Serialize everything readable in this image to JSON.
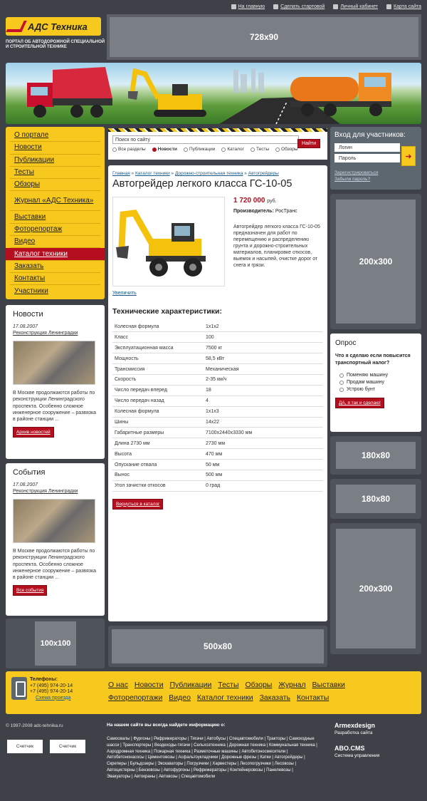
{
  "toplinks": {
    "home": "На главную",
    "start": "Сделать стартовой",
    "cabinet": "Личный кабинет",
    "map": "Карта сайта"
  },
  "logo": {
    "text": "АДС Техника",
    "tagline": "ПОРТАЛ ОБ АВТОДОРОЖНОЙ СПЕЦИАЛЬНОЙ И СТРОИТЕЛЬНОЙ ТЕХНИКЕ"
  },
  "banners": {
    "top": "728x90",
    "r1": "200x300",
    "r2": "180x80",
    "r3": "180x80",
    "r4": "200x300",
    "l1": "100x100",
    "c1": "500x80"
  },
  "nav": [
    "О портале",
    "Новости",
    "Публикации",
    "Тесты",
    "Обзоры",
    "Журнал «АДС Техника»",
    "Выставки",
    "Фоторепортаж",
    "Видео",
    "Каталог техники",
    "Заказать",
    "Контакты",
    "Участники"
  ],
  "news": {
    "title": "Новости",
    "date": "17.08.2007",
    "link": "Реконструкция Ленинградки",
    "text": "В Москве продолжаются работы по реконструкции Ленинградского проспекта. Особенно сложное инженерное сооружение – развязка в районе станции ...",
    "button": "Архив новостей"
  },
  "events": {
    "title": "События",
    "date": "17.08.2007",
    "link": "Реконструкция Ленинградки",
    "text": "В Москве продолжаются работы по реконструкции Ленинградского проспекта. Особенно сложное инженерное сооружение – развязка в районе станции ...",
    "button": "Все события"
  },
  "search": {
    "placeholder": "Поиск по сайту",
    "go": "Найти",
    "options": [
      "Все разделы",
      "Новости",
      "Публикации",
      "Каталог",
      "Тесты",
      "Обзоры"
    ]
  },
  "crumbs": [
    "Главная",
    "Каталог техники",
    "Дорожно-строительная техника",
    "Автогрейдеры"
  ],
  "product": {
    "title": "Автогрейдер легкого класса ГС-10-05",
    "price": "1 720 000",
    "currency": "руб.",
    "mfr_label": "Производитель:",
    "mfr": "РосТранс",
    "desc": "Автогрейдер легкого класса ГС-10-05 предназначен для работ по перемещению и распределению грунта и дорожно-строительных материалов, планировке откосов, выемок и насыпей, очистке дорог от снега и грязи.",
    "zoom": "Увеличить",
    "specs_title": "Технические характеристики:",
    "specs": [
      [
        "Колесная формула",
        "1х1х2"
      ],
      [
        "Класс",
        "100"
      ],
      [
        "Эксплуатационная масса",
        "7500 кг"
      ],
      [
        "Мощность",
        "58,5 кВт"
      ],
      [
        "Трансмиссия",
        "Механическая"
      ],
      [
        "Скорость",
        "2-35 км/ч"
      ],
      [
        "Число передач вперед",
        "18"
      ],
      [
        "Число передач назад",
        "4"
      ],
      [
        "Колесная формула",
        "1х1х3"
      ],
      [
        "Шины",
        "14х22"
      ],
      [
        "Габаритные размеры",
        "7100х2440х3330 мм"
      ],
      [
        "Длина 2730 мм",
        "2730 мм"
      ],
      [
        "Высота",
        "470 мм"
      ],
      [
        "Опускание отвала",
        "50 мм"
      ],
      [
        "Вынос",
        "500 мм"
      ],
      [
        "Угол зачистки откосов",
        "0 град"
      ]
    ],
    "back": "Вернуться в каталог"
  },
  "login": {
    "title": "Вход для участников:",
    "login": "Логин",
    "password": "Пароль",
    "register": "Зарегистрироваться",
    "forgot": "Забыли пароль?"
  },
  "poll": {
    "title": "Опрос",
    "question": "Что я сделаю если повысится транспортный налог?",
    "options": [
      "Поменяю машину",
      "Продам машину",
      "Устрою бунт"
    ],
    "button": "ДА, я так и сделаю!"
  },
  "footer": {
    "phones_label": "Телефоны:",
    "phone1": "+7 (495) 974-20-14",
    "phone2": "+7 (495) 974-20-14",
    "map": "Схема проезда",
    "nav": [
      "О нас",
      "Новости",
      "Публикации",
      "Тесты",
      "Обзоры",
      "Журнал",
      "Выставки",
      "Фоторепортажи",
      "Видео",
      "Каталог техники",
      "Заказать",
      "Контакты"
    ],
    "copy": "© 1997-2008 adc-tehnika.ru",
    "counter1": "Счетчик",
    "counter2": "Счетчик",
    "cats_title": "На нашем сайте вы всегда найдете информацию о:",
    "cats": "Самосвалы | Фургоны | Рефрижераторы | Тягачи | Автобусы | Спецавтомобили | Тракторы | Самоходные шасси | Транспортеры | Вездеходы-тягачи | Сельхозтехника | Дорожная техника | Коммунальная техника | Аэродромная техника | Пожарная техника | Разметочные машины | Автобетоносмесители | Автобетононасосы | Цементовозы | Асфальтоукладчики | Дорожные фрезы | Катки | Автогрейдеры | Скреперы | Бульдозеры | Экскаваторы | Погрузчики | Харвестеры | Лесопогрузчики | Лесовозы | Автоцистерны | Бензовозы | Автофургоны | Рефрижераторы | Контейнеровозы | Панелевозы | Эвакуаторы | Автокраны | Автовозы | Спецавтомобили",
    "armex": "Armexdesign",
    "armex_sub": "Разработка сайта",
    "abo": "ABO.CMS",
    "abo_sub": "Система управления"
  }
}
